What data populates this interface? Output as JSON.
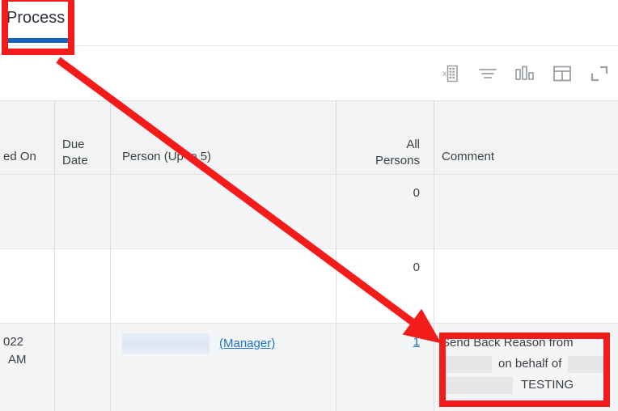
{
  "tabs": {
    "active_label": "Process"
  },
  "toolbar": {
    "icons": [
      {
        "name": "export-excel-icon",
        "label": "Export to Excel"
      },
      {
        "name": "filter-icon",
        "label": "Filter"
      },
      {
        "name": "bar-chart-icon",
        "label": "Chart view"
      },
      {
        "name": "layout-table-icon",
        "label": "Table layout"
      },
      {
        "name": "expand-fullscreen-icon",
        "label": "Expand"
      }
    ]
  },
  "table": {
    "columns": [
      {
        "key": "created_on",
        "label": "ed On",
        "align": "left"
      },
      {
        "key": "due_date",
        "label": "Due\nDate",
        "align": "left"
      },
      {
        "key": "person",
        "label": "Person (Up to 5)",
        "align": "left"
      },
      {
        "key": "all_persons",
        "label": "All\nPersons",
        "align": "right"
      },
      {
        "key": "comment",
        "label": "Comment",
        "align": "left"
      }
    ],
    "column_labels": {
      "created_on": "ed On",
      "due_date_line1": "Due",
      "due_date_line2": "Date",
      "person": "Person (Up to 5)",
      "all_persons_line1": "All",
      "all_persons_line2": "Persons",
      "comment": "Comment"
    },
    "rows": [
      {
        "created_on": "",
        "due_date": "",
        "person": "",
        "all_persons": "0",
        "all_persons_is_link": false,
        "comment": ""
      },
      {
        "created_on": "",
        "due_date": "",
        "person": "",
        "all_persons": "0",
        "all_persons_is_link": false,
        "comment": ""
      },
      {
        "created_on_line1": "022",
        "created_on_line2": "AM",
        "due_date": "",
        "person_role": "(Manager)",
        "person_name_redacted": true,
        "all_persons": "1",
        "all_persons_is_link": true,
        "comment_line1": "Send Back Reason from",
        "comment_line2": "on behalf of",
        "comment_line3": "TESTING"
      }
    ]
  },
  "annotations": {
    "tab_highlight": "Process",
    "comment_highlight": "Send Back Reason from ... on behalf of ... TESTING",
    "arrow_color": "#f41b1b",
    "box_color": "#f41b1b"
  },
  "colors": {
    "accent_blue": "#1565c0",
    "link_blue": "#1a73c8",
    "header_bg": "#f1f3f4",
    "row_alt_bg": "#f4f5f7",
    "annotation_red": "#f41b1b",
    "text": "#3c4043"
  }
}
